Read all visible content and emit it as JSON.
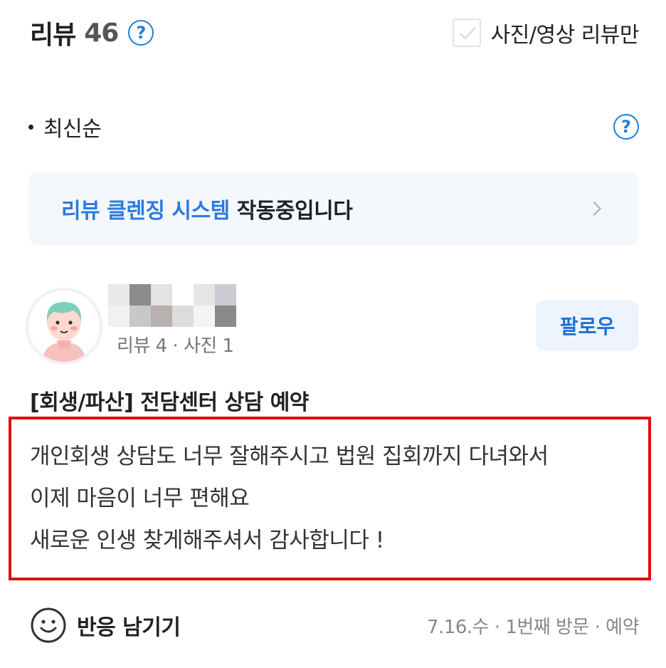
{
  "header": {
    "title": "리뷰",
    "count": "46",
    "help_icon": "question-circle-icon",
    "filter_label": "사진/영상 리뷰만",
    "filter_checked": false
  },
  "sort": {
    "label": "최신순",
    "help_icon": "question-circle-icon"
  },
  "banner": {
    "highlight": "리뷰 클렌징 시스템",
    "text": "작동중입니다",
    "chevron_icon": "chevron-right-icon"
  },
  "reviewer": {
    "meta": "리뷰 4 · 사진 1",
    "follow_label": "팔로우"
  },
  "review": {
    "product": "[회생/파산] 전담센터 상담 예약",
    "lines": [
      "개인회생 상담도 너무 잘해주시고 법원 집회까지 다녀와서",
      "이제 마음이 너무 편해요",
      "새로운 인생 찾게해주셔서 감사합니다 !"
    ]
  },
  "footer": {
    "react_label": "반응 남기기",
    "react_icon": "smile-icon",
    "visit_info": "7.16.수 · 1번째 방문 · 예약"
  },
  "colors": {
    "accent_blue": "#2b7be0",
    "highlight_border": "#e01010",
    "banner_bg": "#f4f8fd"
  }
}
